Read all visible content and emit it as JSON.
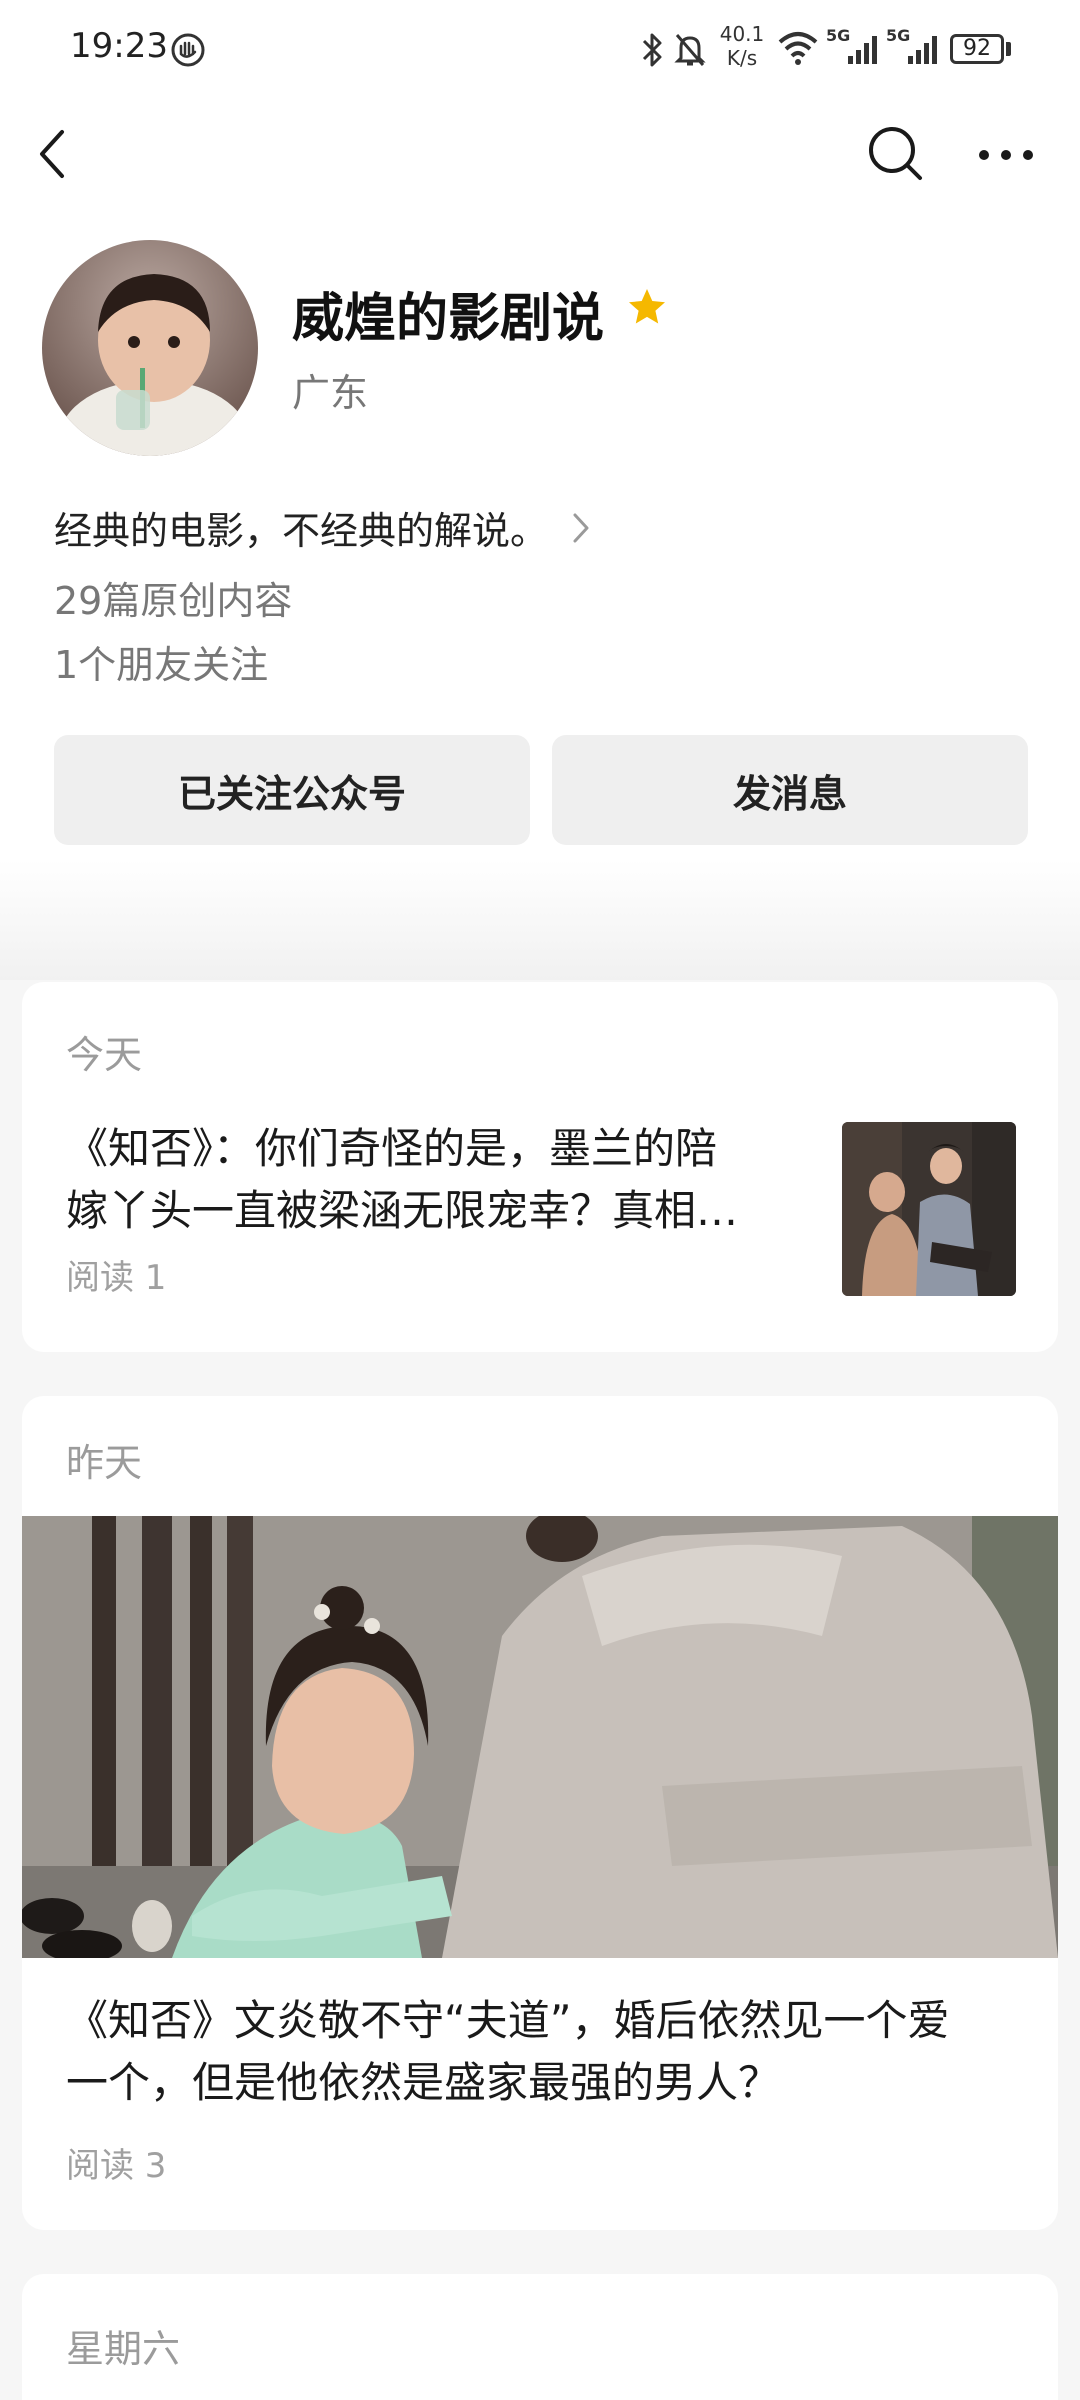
{
  "status_bar": {
    "time": "19:23",
    "net_speed_value": "40.1",
    "net_speed_unit": "K/s",
    "sim1_label": "5G",
    "sim2_label": "5G",
    "battery": "92"
  },
  "account": {
    "name": "威煌的影剧说",
    "region": "广东",
    "bio": "经典的电影，不经典的解说。",
    "original_count": "29篇原创内容",
    "friends_following": "1个朋友关注"
  },
  "actions": {
    "followed_label": "已关注公众号",
    "message_label": "发消息"
  },
  "feed": [
    {
      "date": "今天",
      "title_line1": "《知否》：你们奇怪的是，墨兰的陪",
      "title_line2": "嫁丫头一直被梁涵无限宠幸？真相…",
      "reads": "阅读 1"
    },
    {
      "date": "昨天",
      "title_line1": "《知否》文炎敬不守“夫道”，婚后依然见一个爱",
      "title_line2": "一个，但是他依然是盛家最强的男人？",
      "reads": "阅读 3"
    },
    {
      "date": "星期六"
    }
  ],
  "colors": {
    "star": "#f5b800",
    "muted_text": "#9b9b9b",
    "button_bg": "#efefef",
    "page_bg": "#f6f6f6"
  },
  "icons": [
    "back-icon",
    "search-icon",
    "more-icon",
    "verified-star-icon",
    "chevron-right-icon",
    "bluetooth-icon",
    "mute-bell-icon",
    "wifi-icon",
    "signal-icon",
    "battery-icon"
  ]
}
